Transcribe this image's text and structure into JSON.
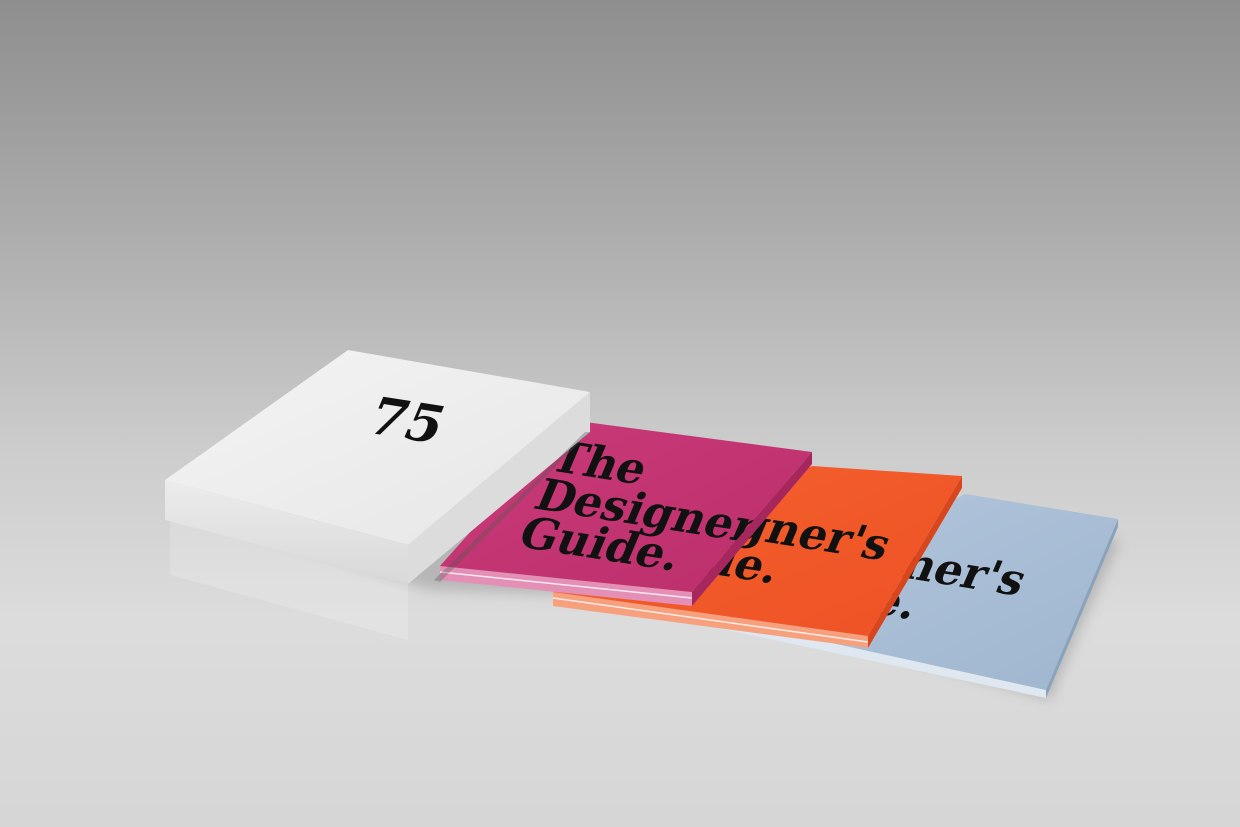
{
  "scene": {
    "slipcase": {
      "number": "75",
      "color": "#eeeeee"
    },
    "booklets": [
      {
        "color": "#c43474",
        "cover_lines": [
          "The",
          "Designer's",
          "Guide."
        ]
      },
      {
        "color": "#f15a2b",
        "cover_lines": [
          "igner's",
          "de."
        ]
      },
      {
        "color": "#a9bfd8",
        "cover_lines": [
          "gner's",
          "ie."
        ]
      }
    ],
    "background_color": "#c8c8c8"
  }
}
